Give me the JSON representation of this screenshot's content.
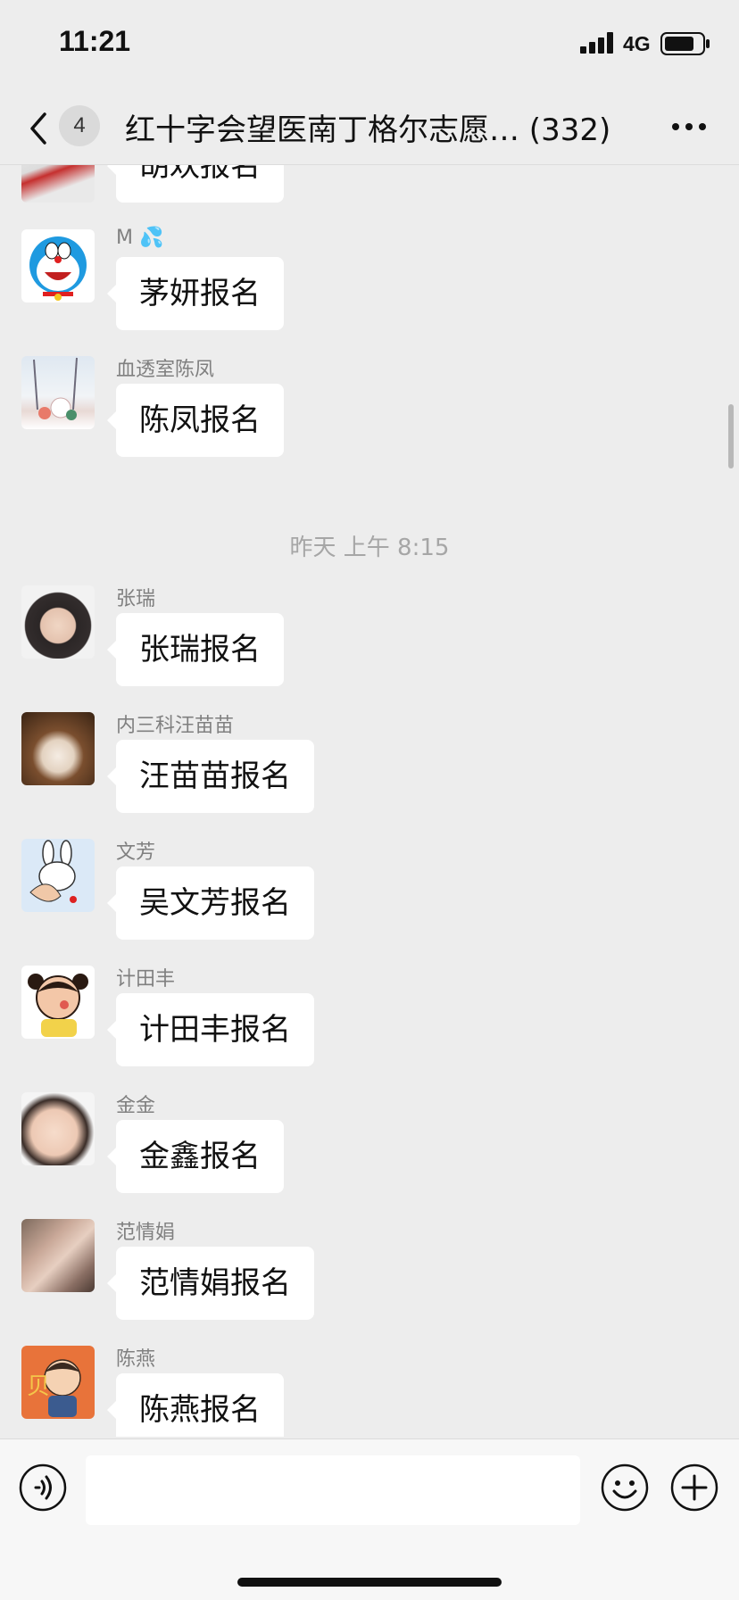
{
  "status_bar": {
    "time": "11:21",
    "network": "4G"
  },
  "header": {
    "unread_count": "4",
    "title": "红十字会望医南丁格尔志愿… (332)",
    "icons": [
      "back-chevron-icon",
      "more-dots-icon"
    ]
  },
  "chat": {
    "time_divider": "昨天 上午 8:15",
    "messages": [
      {
        "sender": "",
        "text": "胡欢报名",
        "avatar": "avatar-photo-red-toy"
      },
      {
        "sender": "M 💦",
        "text": "茅妍报名",
        "avatar": "avatar-doraemon"
      },
      {
        "sender": "血透室陈凤",
        "text": "陈凤报名",
        "avatar": "avatar-winter-scene"
      },
      {
        "sender": "张瑞",
        "text": "张瑞报名",
        "avatar": "avatar-portrait-boy"
      },
      {
        "sender": "内三科汪苗苗",
        "text": "汪苗苗报名",
        "avatar": "avatar-kitten"
      },
      {
        "sender": "文芳",
        "text": "吴文芳报名",
        "avatar": "avatar-cartoon-rabbit"
      },
      {
        "sender": "计田丰",
        "text": "计田丰报名",
        "avatar": "avatar-cartoon-girl"
      },
      {
        "sender": "金金",
        "text": "金鑫报名",
        "avatar": "avatar-baby"
      },
      {
        "sender": "范情娟",
        "text": "范情娟报名",
        "avatar": "avatar-group-selfie"
      },
      {
        "sender": "陈燕",
        "text": "陈燕报名",
        "avatar": "avatar-cartoon-kid"
      }
    ]
  },
  "input_bar": {
    "placeholder": "",
    "icons": [
      "voice-icon",
      "emoji-icon",
      "plus-icon"
    ]
  },
  "colors": {
    "background": "#ededed",
    "bubble": "#ffffff",
    "muted_text": "#808080"
  }
}
